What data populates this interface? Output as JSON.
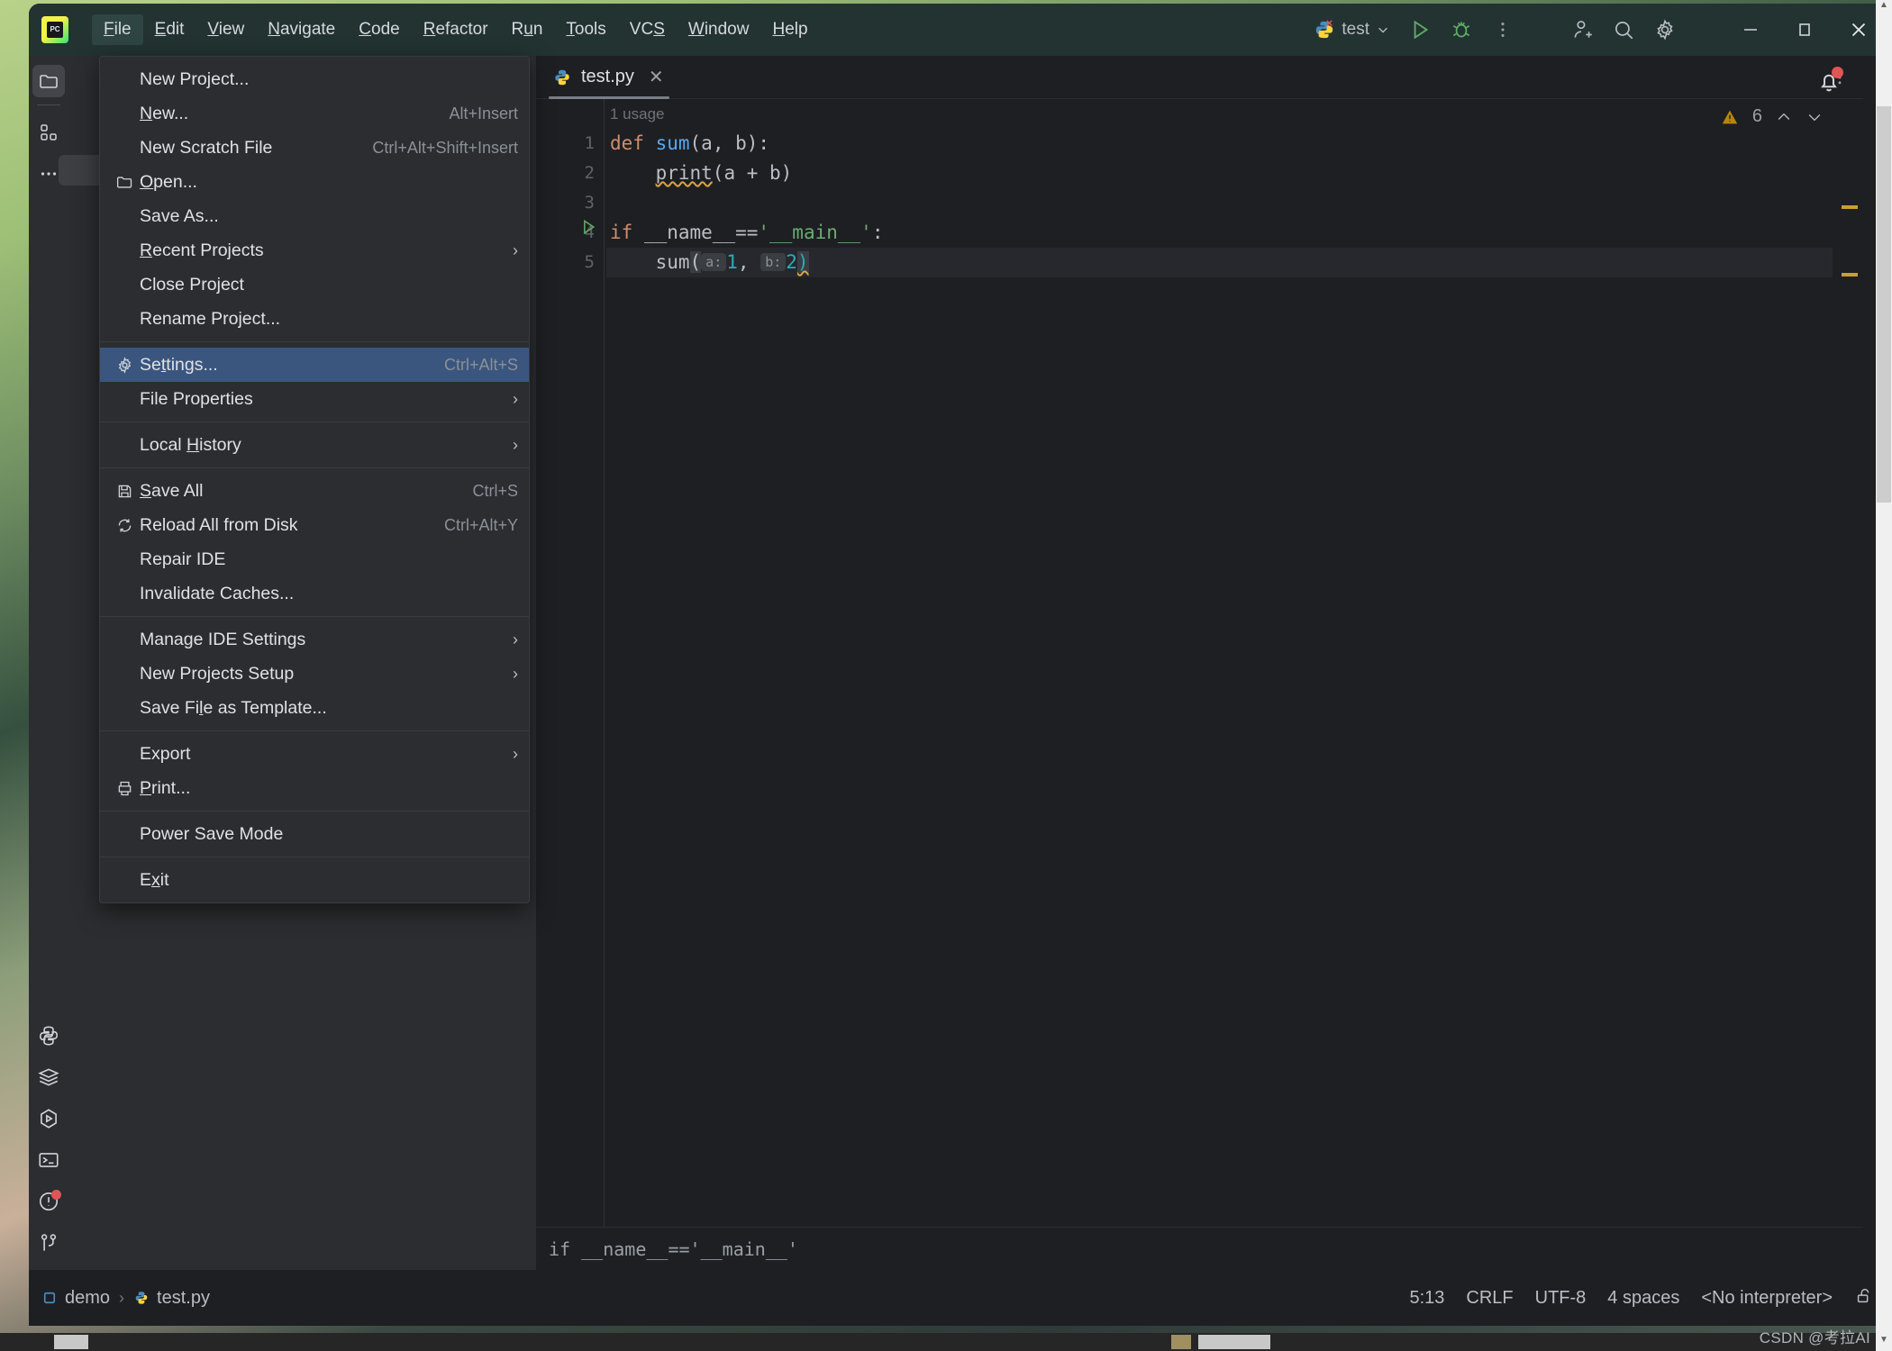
{
  "window": {
    "app_logo": "pycharm-logo",
    "menus": [
      {
        "label": "File",
        "mnemonic": "F",
        "active": true
      },
      {
        "label": "Edit",
        "mnemonic": "E",
        "active": false
      },
      {
        "label": "View",
        "mnemonic": "V",
        "active": false
      },
      {
        "label": "Navigate",
        "mnemonic": "N",
        "active": false
      },
      {
        "label": "Code",
        "mnemonic": "C",
        "active": false
      },
      {
        "label": "Refactor",
        "mnemonic": "R",
        "active": false
      },
      {
        "label": "Run",
        "mnemonic": "u",
        "active": false
      },
      {
        "label": "Tools",
        "mnemonic": "T",
        "active": false
      },
      {
        "label": "VCS",
        "mnemonic": "S",
        "active": false
      },
      {
        "label": "Window",
        "mnemonic": "W",
        "active": false
      },
      {
        "label": "Help",
        "mnemonic": "H",
        "active": false
      }
    ],
    "run_config": "test",
    "window_controls": {
      "minimize": "–",
      "maximize": "▭",
      "close": "✕"
    }
  },
  "file_menu": {
    "items": [
      {
        "label": "New Project...",
        "icon": null,
        "shortcut": "",
        "submenu": false,
        "selected": false,
        "mnemonic": ""
      },
      {
        "label": "New...",
        "icon": null,
        "shortcut": "Alt+Insert",
        "submenu": false,
        "selected": false,
        "mnemonic": "N"
      },
      {
        "label": "New Scratch File",
        "icon": null,
        "shortcut": "Ctrl+Alt+Shift+Insert",
        "submenu": false,
        "selected": false,
        "mnemonic": ""
      },
      {
        "label": "Open...",
        "icon": "folder-icon",
        "shortcut": "",
        "submenu": false,
        "selected": false,
        "mnemonic": "O"
      },
      {
        "label": "Save As...",
        "icon": null,
        "shortcut": "",
        "submenu": false,
        "selected": false,
        "mnemonic": ""
      },
      {
        "label": "Recent Projects",
        "icon": null,
        "shortcut": "",
        "submenu": true,
        "selected": false,
        "mnemonic": "R"
      },
      {
        "label": "Close Project",
        "icon": null,
        "shortcut": "",
        "submenu": false,
        "selected": false,
        "mnemonic": ""
      },
      {
        "label": "Rename Project...",
        "icon": null,
        "shortcut": "",
        "submenu": false,
        "selected": false,
        "mnemonic": ""
      },
      {
        "separator": true
      },
      {
        "label": "Settings...",
        "icon": "gear-icon",
        "shortcut": "Ctrl+Alt+S",
        "submenu": false,
        "selected": true,
        "mnemonic": "t"
      },
      {
        "label": "File Properties",
        "icon": null,
        "shortcut": "",
        "submenu": true,
        "selected": false,
        "mnemonic": ""
      },
      {
        "separator": true
      },
      {
        "label": "Local History",
        "icon": null,
        "shortcut": "",
        "submenu": true,
        "selected": false,
        "mnemonic": "H"
      },
      {
        "separator": true
      },
      {
        "label": "Save All",
        "icon": "save-icon",
        "shortcut": "Ctrl+S",
        "submenu": false,
        "selected": false,
        "mnemonic": "S"
      },
      {
        "label": "Reload All from Disk",
        "icon": "reload-icon",
        "shortcut": "Ctrl+Alt+Y",
        "submenu": false,
        "selected": false,
        "mnemonic": ""
      },
      {
        "label": "Repair IDE",
        "icon": null,
        "shortcut": "",
        "submenu": false,
        "selected": false,
        "mnemonic": ""
      },
      {
        "label": "Invalidate Caches...",
        "icon": null,
        "shortcut": "",
        "submenu": false,
        "selected": false,
        "mnemonic": ""
      },
      {
        "separator": true
      },
      {
        "label": "Manage IDE Settings",
        "icon": null,
        "shortcut": "",
        "submenu": true,
        "selected": false,
        "mnemonic": ""
      },
      {
        "label": "New Projects Setup",
        "icon": null,
        "shortcut": "",
        "submenu": true,
        "selected": false,
        "mnemonic": ""
      },
      {
        "label": "Save File as Template...",
        "icon": null,
        "shortcut": "",
        "submenu": false,
        "selected": false,
        "mnemonic": "l"
      },
      {
        "separator": true
      },
      {
        "label": "Export",
        "icon": null,
        "shortcut": "",
        "submenu": true,
        "selected": false,
        "mnemonic": ""
      },
      {
        "label": "Print...",
        "icon": "print-icon",
        "shortcut": "",
        "submenu": false,
        "selected": false,
        "mnemonic": "P"
      },
      {
        "separator": true
      },
      {
        "label": "Power Save Mode",
        "icon": null,
        "shortcut": "",
        "submenu": false,
        "selected": false,
        "mnemonic": ""
      },
      {
        "separator": true
      },
      {
        "label": "Exit",
        "icon": null,
        "shortcut": "",
        "submenu": false,
        "selected": false,
        "mnemonic": "x"
      }
    ]
  },
  "left_toolbar": {
    "top_items": [
      {
        "name": "project-icon",
        "selected": true
      },
      {
        "name": "structure-icon",
        "selected": false
      },
      {
        "name": "more-tool-windows-icon",
        "selected": false
      }
    ],
    "bottom_items": [
      {
        "name": "python-packages-icon",
        "badge": false
      },
      {
        "name": "database-icon",
        "badge": false
      },
      {
        "name": "run-icon",
        "badge": false
      },
      {
        "name": "terminal-icon",
        "badge": false
      },
      {
        "name": "problems-icon",
        "badge": true
      },
      {
        "name": "version-control-icon",
        "badge": false
      }
    ]
  },
  "editor": {
    "tab": {
      "filename": "test.py",
      "icon": "python-file-icon",
      "close": "✕"
    },
    "usage_hint": "1 usage",
    "inspection": {
      "warning_count": "6",
      "icon": "warning-triangle-icon"
    },
    "lines": [
      {
        "num": "1",
        "tokens": [
          {
            "t": "def",
            "c": "kw"
          },
          {
            "t": " ",
            "c": "pl"
          },
          {
            "t": "sum",
            "c": "fn"
          },
          {
            "t": "(a, b):",
            "c": "pl"
          }
        ]
      },
      {
        "num": "2",
        "tokens": [
          {
            "t": "    ",
            "c": "pl"
          },
          {
            "t": "print",
            "c": "pl warn-u"
          },
          {
            "t": "(a + b)",
            "c": "pl"
          }
        ]
      },
      {
        "num": "3",
        "tokens": []
      },
      {
        "num": "4",
        "tokens": [
          {
            "t": "if",
            "c": "kw"
          },
          {
            "t": " __name__==",
            "c": "pl"
          },
          {
            "t": "'__main__'",
            "c": "str"
          },
          {
            "t": ":",
            "c": "pl"
          }
        ]
      },
      {
        "num": "5",
        "tokens": []
      }
    ],
    "line5": {
      "indent": "    ",
      "call": "sum",
      "open_paren": "(",
      "hint_a": "a:",
      "val_a": "1",
      "comma": ", ",
      "hint_b": "b:",
      "val_b": "2",
      "close_paren": ")"
    },
    "breadcrumb_code": "if __name__=='__main__'"
  },
  "status_bar": {
    "breadcrumbs": [
      {
        "label": "demo",
        "icon": "module-icon"
      },
      {
        "label": "test.py",
        "icon": "python-file-icon"
      }
    ],
    "separator": "›",
    "right_items": [
      {
        "label": "5:13",
        "name": "caret-position"
      },
      {
        "label": "CRLF",
        "name": "line-separator"
      },
      {
        "label": "UTF-8",
        "name": "file-encoding"
      },
      {
        "label": "4 spaces",
        "name": "indent-setting"
      },
      {
        "label": "<No interpreter>",
        "name": "python-interpreter"
      }
    ],
    "lock_icon": "unlocked-padlock-icon"
  },
  "watermark": "CSDN @考拉AI",
  "colors": {
    "accent_selection": "#3a567f",
    "menu_bg": "#2b2d30",
    "editor_bg": "#1e1f22",
    "titlebar_bg": "#223332",
    "keyword": "#cf8e6d",
    "function": "#56a8f5",
    "string": "#6aab73",
    "number": "#2aacb8",
    "warning": "#d9a343",
    "badge_red": "#e05555"
  }
}
